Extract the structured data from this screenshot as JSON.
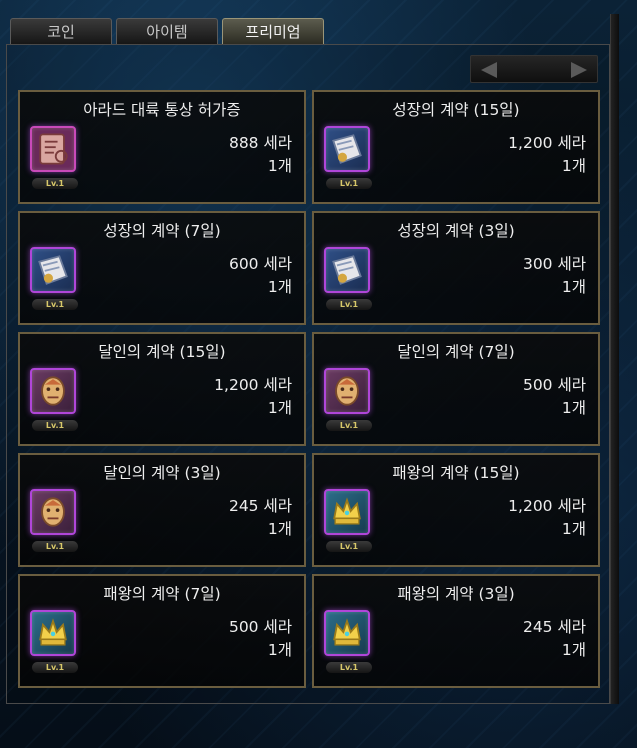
{
  "tabs": [
    {
      "label": "코인"
    },
    {
      "label": "아이템"
    },
    {
      "label": "프리미엄"
    }
  ],
  "active_tab": 2,
  "items": [
    {
      "title": "아라드 대륙 통상 허가증",
      "price": "888 세라",
      "qty": "1개",
      "level": "Lv.1",
      "icon": "permit-scroll-icon"
    },
    {
      "title": "성장의 계약 (15일)",
      "price": "1,200 세라",
      "qty": "1개",
      "level": "Lv.1",
      "icon": "growth-contract-icon"
    },
    {
      "title": "성장의 계약 (7일)",
      "price": "600 세라",
      "qty": "1개",
      "level": "Lv.1",
      "icon": "growth-contract-icon"
    },
    {
      "title": "성장의 계약 (3일)",
      "price": "300 세라",
      "qty": "1개",
      "level": "Lv.1",
      "icon": "growth-contract-icon"
    },
    {
      "title": "달인의 계약 (15일)",
      "price": "1,200 세라",
      "qty": "1개",
      "level": "Lv.1",
      "icon": "master-contract-icon"
    },
    {
      "title": "달인의 계약 (7일)",
      "price": "500 세라",
      "qty": "1개",
      "level": "Lv.1",
      "icon": "master-contract-icon"
    },
    {
      "title": "달인의 계약 (3일)",
      "price": "245 세라",
      "qty": "1개",
      "level": "Lv.1",
      "icon": "master-contract-icon"
    },
    {
      "title": "패왕의 계약 (15일)",
      "price": "1,200 세라",
      "qty": "1개",
      "level": "Lv.1",
      "icon": "king-contract-icon"
    },
    {
      "title": "패왕의 계약 (7일)",
      "price": "500 세라",
      "qty": "1개",
      "level": "Lv.1",
      "icon": "king-contract-icon"
    },
    {
      "title": "패왕의 계약 (3일)",
      "price": "245 세라",
      "qty": "1개",
      "level": "Lv.1",
      "icon": "king-contract-icon"
    }
  ],
  "colors": {
    "card_border": "#6a5d3f",
    "icon_glow": "#b046d9",
    "level_text": "#d8c86a"
  }
}
